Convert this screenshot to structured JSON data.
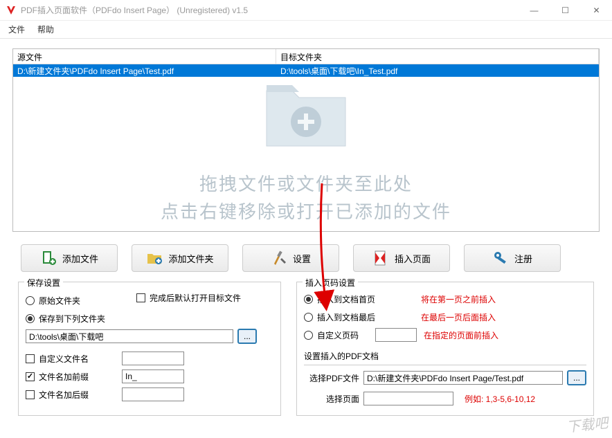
{
  "window": {
    "title": "PDF插入页面软件（PDFdo Insert Page） (Unregistered) v1.5"
  },
  "menu": {
    "file": "文件",
    "help": "帮助"
  },
  "list": {
    "col_src": "源文件",
    "col_tgt": "目标文件夹",
    "rows": [
      {
        "src": "D:\\新建文件夹\\PDFdo Insert Page\\Test.pdf",
        "tgt": "D:\\tools\\桌面\\下载吧\\In_Test.pdf"
      }
    ]
  },
  "drop_hint": {
    "line1": "拖拽文件或文件夹至此处",
    "line2": "点击右键移除或打开已添加的文件"
  },
  "toolbar": {
    "add_file": "添加文件",
    "add_folder": "添加文件夹",
    "settings": "设置",
    "insert_page": "插入页面",
    "register": "注册"
  },
  "save": {
    "legend": "保存设置",
    "open_after": "完成后默认打开目标文件",
    "orig_folder": "原始文件夹",
    "to_folder": "保存到下列文件夹",
    "to_folder_path": "D:\\tools\\桌面\\下载吧",
    "browse": "...",
    "custom_name": "自定义文件名",
    "prefix": "文件名加前缀",
    "prefix_value": "In_",
    "suffix": "文件名加后缀"
  },
  "insert": {
    "legend": "插入页码设置",
    "opt_first": "插入到文档首页",
    "hint_first": "将在第一页之前插入",
    "opt_last": "插入到文档最后",
    "hint_last": "在最后一页后面插入",
    "opt_custom": "自定义页码",
    "hint_custom": "在指定的页面前插入",
    "custom_value": "",
    "sub_legend": "设置插入的PDF文档",
    "select_pdf": "选择PDF文件",
    "select_pdf_value": "D:\\新建文件夹\\PDFdo Insert Page/Test.pdf",
    "select_page": "选择页面",
    "select_page_value": "",
    "example": "例如: 1,3-5,6-10,12"
  },
  "watermark": "下载吧"
}
